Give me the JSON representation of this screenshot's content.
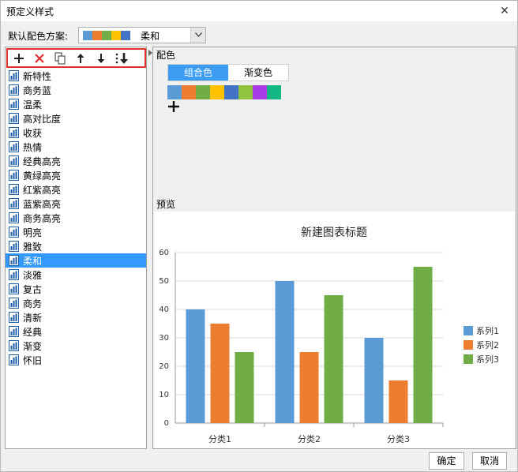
{
  "window": {
    "title": "预定义样式",
    "close_glyph": "✕"
  },
  "scheme": {
    "label": "默认配色方案:",
    "selected": "柔和",
    "swatches": [
      "#5b9bd5",
      "#ed7d31",
      "#70ad47",
      "#ffc000",
      "#4472c4"
    ]
  },
  "toolbar": {
    "icons": [
      "add-icon",
      "delete-icon",
      "copy-icon",
      "move-up-icon",
      "move-down-icon",
      "move-bottom-icon"
    ]
  },
  "styles": [
    "新特性",
    "商务蓝",
    "温柔",
    "高对比度",
    "收获",
    "热情",
    "经典高亮",
    "黄绿高亮",
    "红紫高亮",
    "蓝紫高亮",
    "商务高亮",
    "明亮",
    "雅致",
    "柔和",
    "淡雅",
    "复古",
    "商务",
    "清新",
    "经典",
    "渐变",
    "怀旧"
  ],
  "selected_style": "柔和",
  "color_section": {
    "label": "配色",
    "tabs": [
      "组合色",
      "渐变色"
    ],
    "active_tab": "组合色",
    "palette": [
      "#5b9bd5",
      "#ed7d31",
      "#70ad47",
      "#ffc000",
      "#4472c4",
      "#91c43e",
      "#a83de8",
      "#12b784"
    ]
  },
  "preview": {
    "label": "预览"
  },
  "chart_data": {
    "type": "bar",
    "title": "新建图表标题",
    "categories": [
      "分类1",
      "分类2",
      "分类3"
    ],
    "series": [
      {
        "name": "系列1",
        "color": "#5b9bd5",
        "values": [
          40,
          50,
          30
        ]
      },
      {
        "name": "系列2",
        "color": "#ed7d31",
        "values": [
          35,
          25,
          15
        ]
      },
      {
        "name": "系列3",
        "color": "#70ad47",
        "values": [
          25,
          45,
          55
        ]
      }
    ],
    "ylim": [
      0,
      60
    ],
    "yticks": [
      0,
      10,
      20,
      30,
      40,
      50,
      60
    ],
    "grid": true,
    "legend": "right"
  },
  "footer": {
    "ok": "确定",
    "cancel": "取消"
  }
}
